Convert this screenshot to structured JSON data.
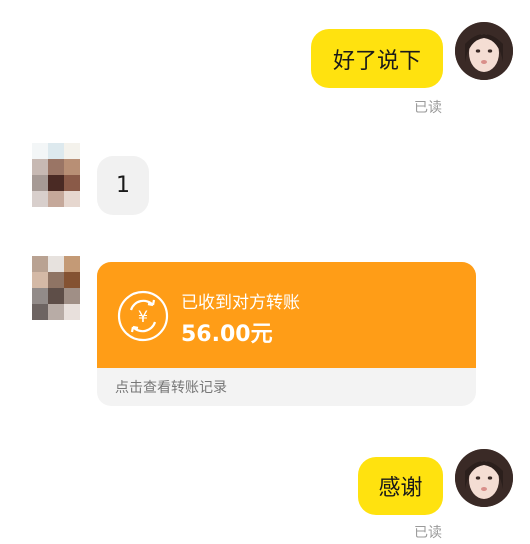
{
  "messages": {
    "m1": {
      "text": "好了说下",
      "status": "已读"
    },
    "m2": {
      "text": "1"
    },
    "m3": {
      "title": "已收到对方转账",
      "amount": "56.00元",
      "link": "点击查看转账记录",
      "currency_symbol": "¥"
    },
    "m4": {
      "text": "感谢",
      "status": "已读"
    }
  },
  "colors": {
    "bubble_out": "#ffe20f",
    "card_orange": "#ff9d17",
    "bubble_in": "#f1f1f1"
  }
}
